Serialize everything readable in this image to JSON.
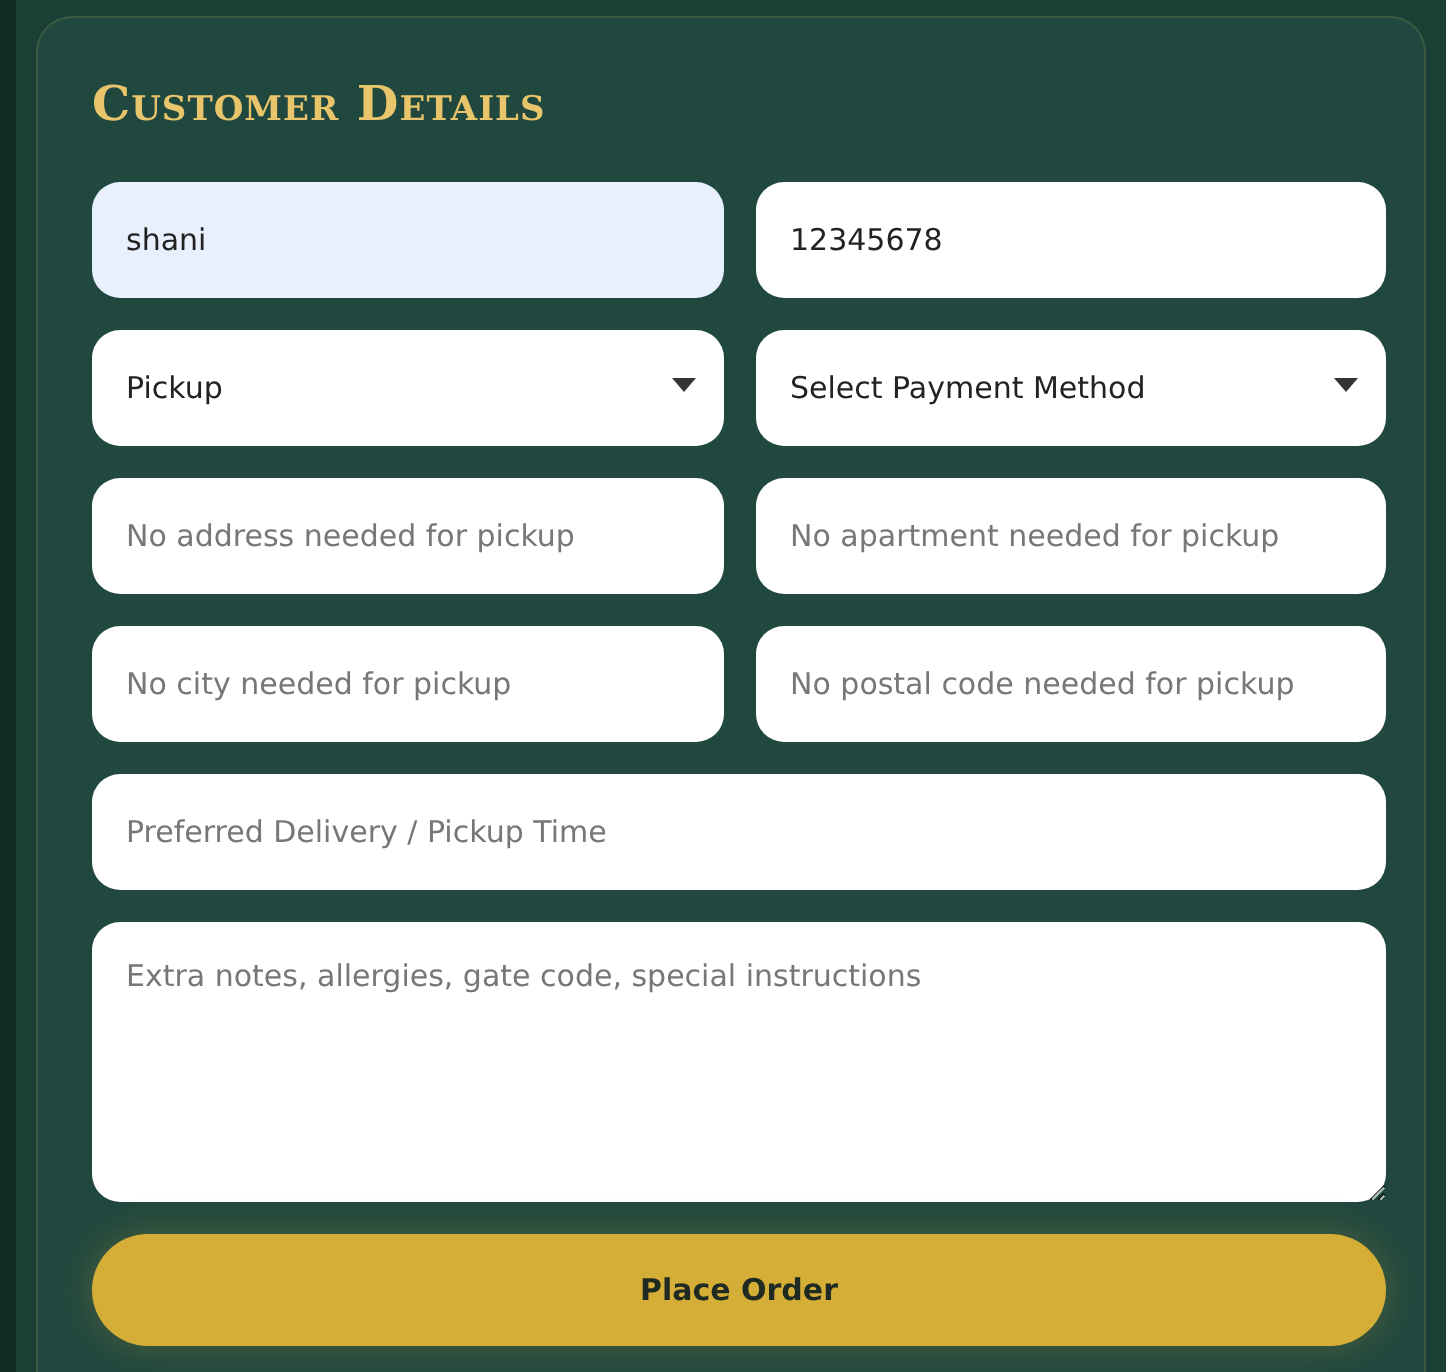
{
  "title": "Customer Details",
  "fields": [
    {
      "kind": "input",
      "value": "shani",
      "autofilled": true
    },
    {
      "kind": "input",
      "value": "12345678",
      "autofilled": false
    },
    {
      "kind": "select",
      "value": "Pickup"
    },
    {
      "kind": "select",
      "value": "Select Payment Method"
    },
    {
      "kind": "input",
      "placeholder": "No address needed for pickup",
      "autofilled": false
    },
    {
      "kind": "input",
      "placeholder": "No apartment needed for pickup",
      "autofilled": false
    },
    {
      "kind": "input",
      "placeholder": "No city needed for pickup",
      "autofilled": false
    },
    {
      "kind": "input",
      "placeholder": "No postal code needed for pickup",
      "autofilled": false
    },
    {
      "kind": "wide",
      "placeholder": "Preferred Delivery / Pickup Time",
      "autofilled": false
    },
    {
      "kind": "textarea",
      "placeholder": "Extra notes, allergies, gate code, special instructions"
    }
  ],
  "button": "Place Order"
}
